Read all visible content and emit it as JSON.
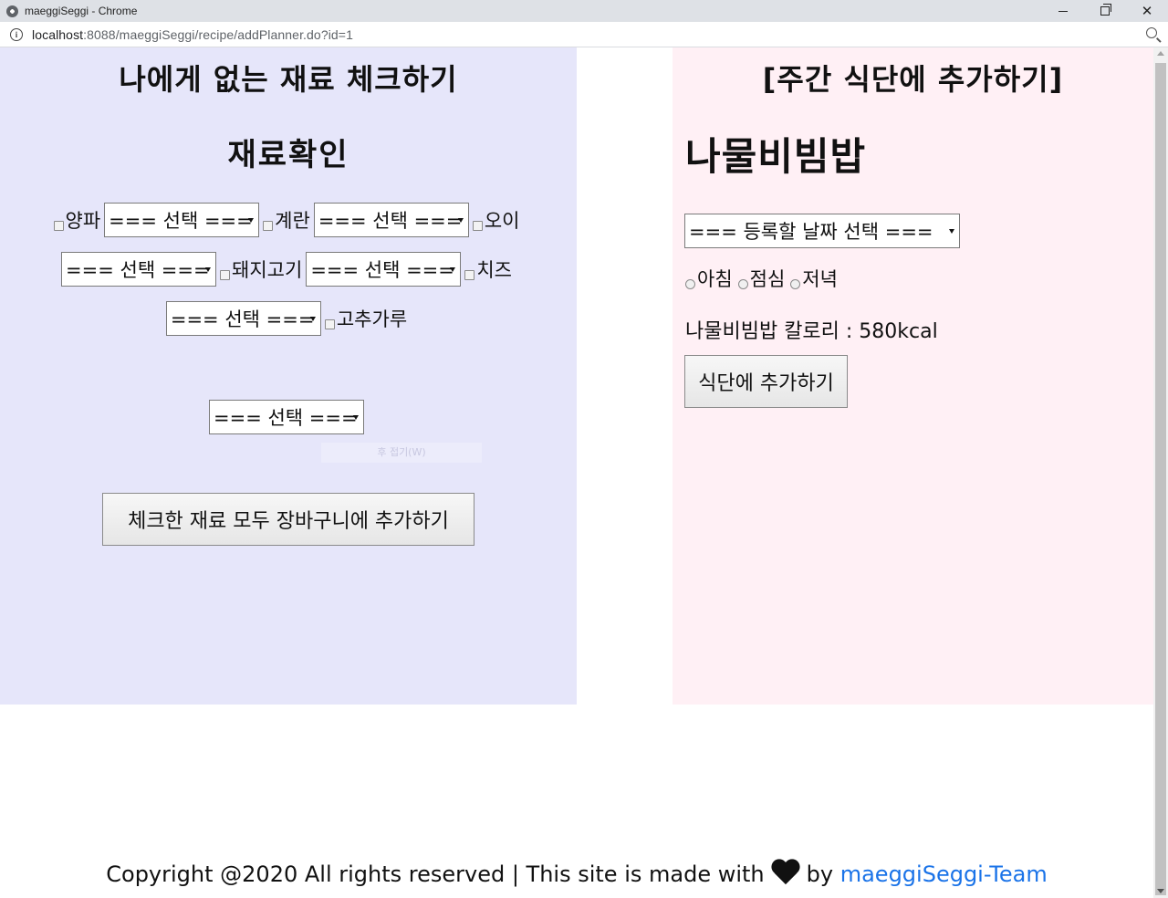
{
  "window": {
    "title": "maeggiSeggi - Chrome",
    "url_host": "localhost",
    "url_rest": ":8088/maeggiSeggi/recipe/addPlanner.do?id=1"
  },
  "left": {
    "title": "나에게 없는 재료 체크하기",
    "subtitle": "재료확인",
    "ingredients": [
      {
        "label": "양파",
        "select": "=== 선택 ==="
      },
      {
        "label": "계란",
        "select": "=== 선택 ==="
      },
      {
        "label": "오이",
        "select": "=== 선택 ==="
      },
      {
        "label": "돼지고기",
        "select": "=== 선택 ==="
      },
      {
        "label": "치즈",
        "select": "=== 선택 ==="
      },
      {
        "label": "고추가루",
        "select": "=== 선택 ==="
      }
    ],
    "extra_select": "=== 선택 ===",
    "ghost_tip": "후 접기(W)",
    "add_cart_button": "체크한 재료 모두 장바구니에 추가하기"
  },
  "right": {
    "title": "[주간 식단에 추가하기]",
    "recipe_name": "나물비빔밥",
    "date_select": "=== 등록할 날짜 선택 ===",
    "meals": [
      "아침",
      "점심",
      "저녁"
    ],
    "calorie_text": "나물비빔밥 칼로리 : 580kcal",
    "add_plan_button": "식단에 추가하기"
  },
  "footer": {
    "text": "Copyright @2020 All rights reserved | This site is made with",
    "by": "by",
    "team": "maeggiSeggi-Team"
  },
  "colors": {
    "left_panel": "#e6e6fa",
    "right_panel": "#fff0f5",
    "link": "#1a73e8"
  }
}
